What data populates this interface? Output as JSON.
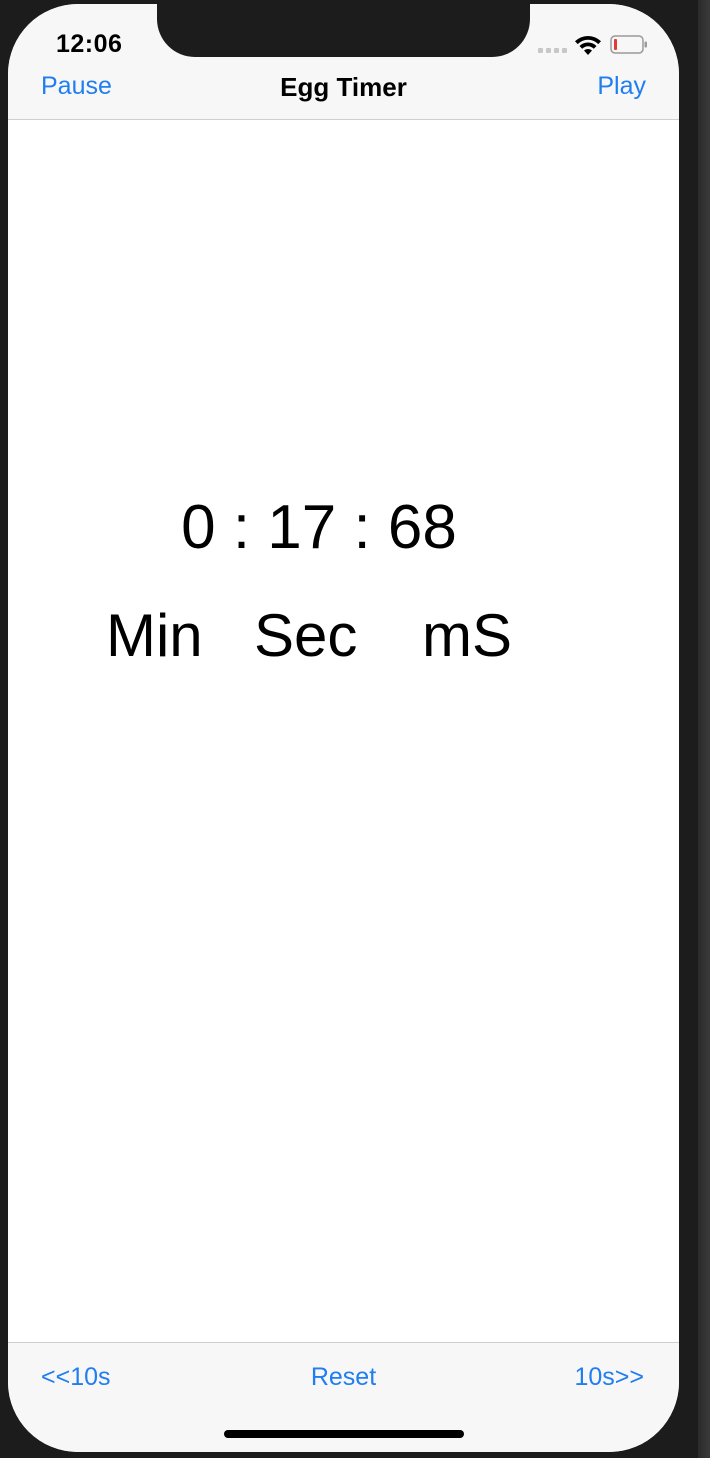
{
  "status_bar": {
    "time": "12:06"
  },
  "nav": {
    "title": "Egg Timer",
    "left_button": "Pause",
    "right_button": "Play"
  },
  "timer": {
    "display": "0 : 17 : 68",
    "minutes": "0",
    "seconds": "17",
    "milliseconds": "68",
    "labels": {
      "min": "Min",
      "sec": "Sec",
      "ms": "mS"
    }
  },
  "toolbar": {
    "back_label": "<<10s",
    "reset_label": "Reset",
    "forward_label": "10s>>"
  },
  "colors": {
    "accent": "#1f7ef0",
    "bar_background": "#f7f7f7",
    "battery_low": "#e53935"
  },
  "icons": {
    "signal": "cellular-signal-icon",
    "wifi": "wifi-icon",
    "battery": "battery-icon"
  }
}
